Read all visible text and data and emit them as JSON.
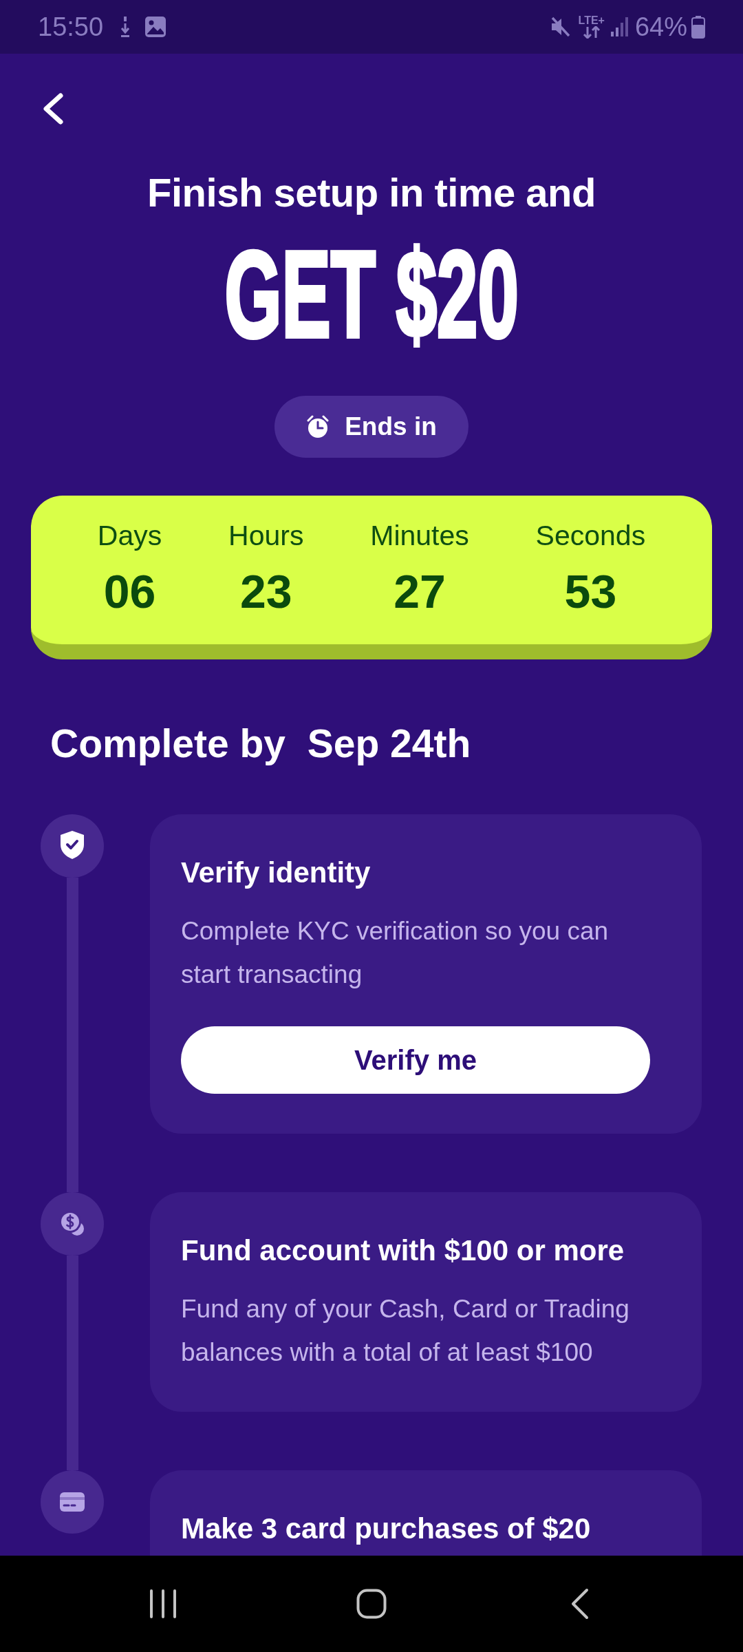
{
  "status_bar": {
    "time": "15:50",
    "network": "LTE+",
    "battery": "64%"
  },
  "promo": {
    "subtitle": "Finish setup in time and",
    "headline": "GET $20",
    "timer_label": "Ends in"
  },
  "countdown": [
    {
      "unit": "Days",
      "value": "06"
    },
    {
      "unit": "Hours",
      "value": "23"
    },
    {
      "unit": "Minutes",
      "value": "27"
    },
    {
      "unit": "Seconds",
      "value": "53"
    }
  ],
  "deadline": "Complete by  Sep 24th",
  "steps": [
    {
      "kind": "identity",
      "current": true,
      "title": "Verify identity",
      "description": "Complete KYC verification so you can start transacting",
      "button": "Verify me"
    },
    {
      "kind": "funding",
      "current": false,
      "title": "Fund account with $100 or more",
      "description": "Fund any of your Cash, Card or Trading balances with a total of at least $100"
    },
    {
      "kind": "card",
      "current": false,
      "title": "Make 3 card purchases of $20"
    }
  ]
}
